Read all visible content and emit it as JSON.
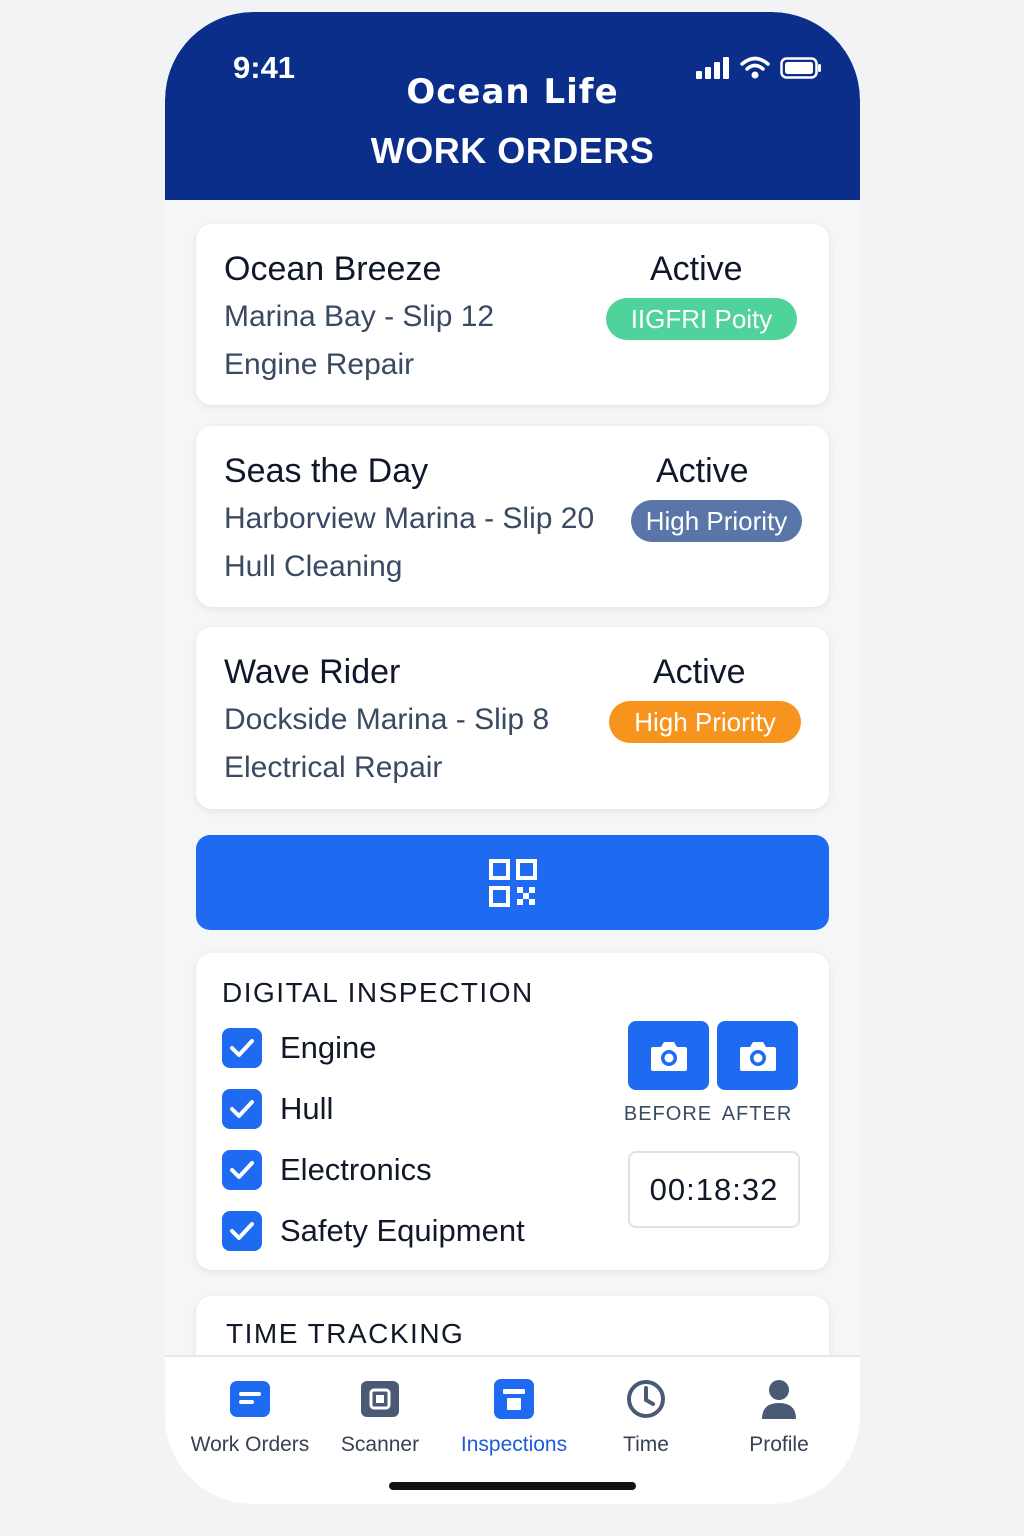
{
  "status_bar": {
    "time": "9:41"
  },
  "header": {
    "app_name": "Ocean Life",
    "title": "WORK ORDERS"
  },
  "work_orders": [
    {
      "name": "Ocean Breeze",
      "location": "Marina Bay - Slip 12",
      "task": "Engine Repair",
      "status": "Active",
      "badge": "IIGFRI Poity",
      "badge_color": "#4fd39a"
    },
    {
      "name": "Seas the Day",
      "location": "Harborview Marina - Slip 20",
      "task": "Hull Cleaning",
      "status": "Active",
      "badge": "High Priority",
      "badge_color": "#5a76a8"
    },
    {
      "name": "Wave Rider",
      "location": "Dockside Marina - Slip 8",
      "task": "Electrical Repair",
      "status": "Active",
      "badge": "High Priority",
      "badge_color": "#f7941d"
    }
  ],
  "scanner_button": {
    "icon": "qr-code-icon"
  },
  "inspection": {
    "title": "DIGITAL INSPECTION",
    "items": [
      {
        "label": "Engine",
        "checked": true
      },
      {
        "label": "Hull",
        "checked": true
      },
      {
        "label": "Electronics",
        "checked": true
      },
      {
        "label": "Safety Equipment",
        "checked": true
      }
    ],
    "before_label": "BEFORE",
    "after_label": "AFTER",
    "timer": "00:18:32"
  },
  "time_tracking": {
    "title": "TIME TRACKING"
  },
  "tabs": [
    {
      "label": "Work Orders",
      "icon": "work-orders-icon",
      "active": false
    },
    {
      "label": "Scanner",
      "icon": "scanner-icon",
      "active": false
    },
    {
      "label": "Inspections",
      "icon": "inspections-icon",
      "active": true
    },
    {
      "label": "Time",
      "icon": "clock-icon",
      "active": false
    },
    {
      "label": "Profile",
      "icon": "person-icon",
      "active": false
    }
  ],
  "colors": {
    "header": "#0a2e8a",
    "accent": "#1e6af0"
  }
}
